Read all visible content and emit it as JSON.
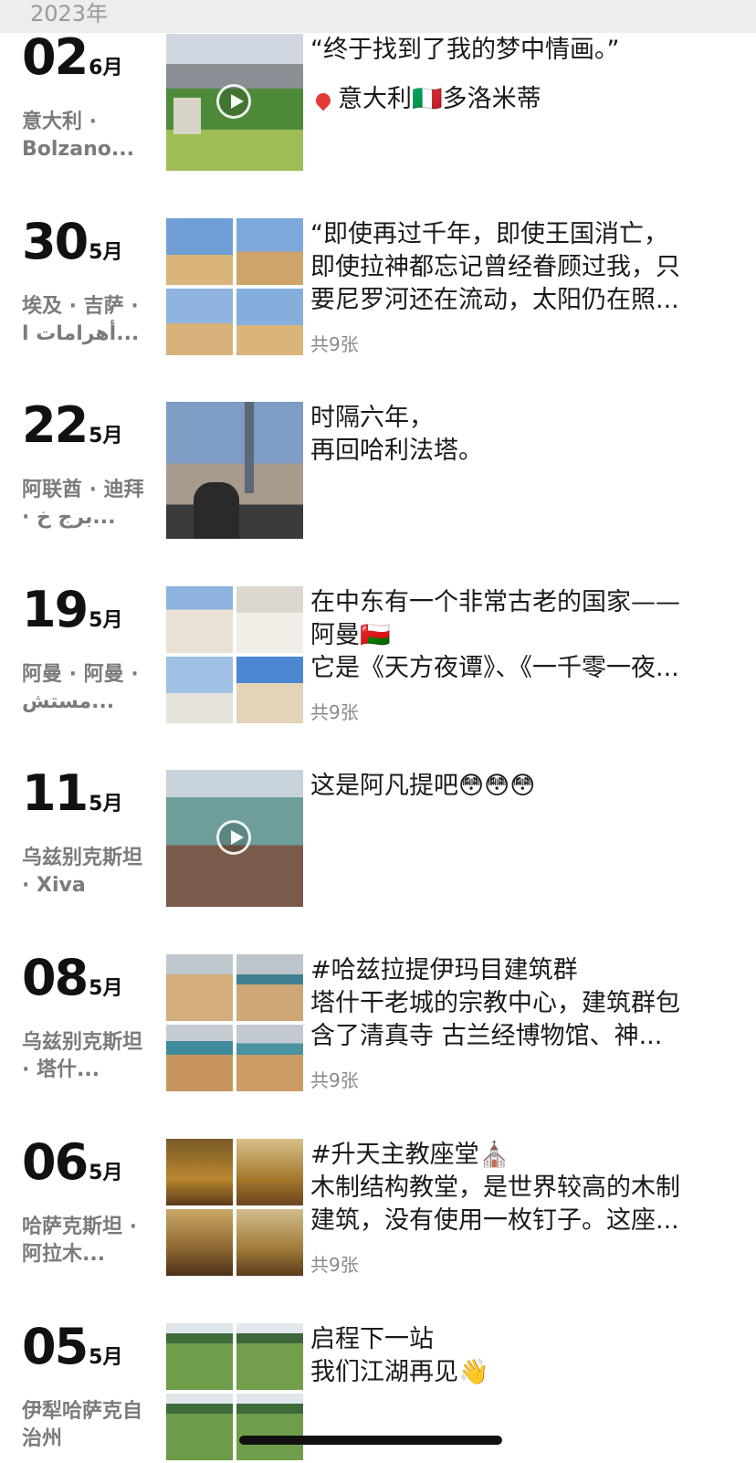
{
  "header": {
    "year": "2023年"
  },
  "posts": [
    {
      "day": "02",
      "month": "6月",
      "location": "意大利 · Bolzano...",
      "media": "video",
      "lines": [
        "“终于找到了我的梦中情画。”",
        "",
        "意大利🇮🇹多洛米蒂"
      ],
      "count": ""
    },
    {
      "day": "30",
      "month": "5月",
      "location": "埃及 · 吉萨 · أهرامات ا...",
      "media": "grid",
      "lines": [
        "“即使再过千年，即使王国消亡，",
        "即使拉神都忘记曾经眷顾过我，只",
        "要尼罗河还在流动，太阳仍在照..."
      ],
      "count": "共9张"
    },
    {
      "day": "22",
      "month": "5月",
      "location": "阿联酋 · 迪拜 · برج خ...",
      "media": "photo",
      "lines": [
        "时隔六年，",
        "再回哈利法塔。"
      ],
      "count": ""
    },
    {
      "day": "19",
      "month": "5月",
      "location": "阿曼 · 阿曼 · مستش...",
      "media": "grid",
      "lines": [
        "在中东有一个非常古老的国家——",
        "阿曼🇴🇲",
        "它是《天方夜谭》、《一千零一夜..."
      ],
      "count": "共9张"
    },
    {
      "day": "11",
      "month": "5月",
      "location": "乌兹别克斯坦 · Xiva",
      "media": "video",
      "lines": [
        "这是阿凡提吧😳😳😳"
      ],
      "count": ""
    },
    {
      "day": "08",
      "month": "5月",
      "location": "乌兹别克斯坦 · 塔什...",
      "media": "grid",
      "lines": [
        "#哈兹拉提伊玛目建筑群",
        "塔什干老城的宗教中心，建筑群包",
        "含了清真寺 古兰经博物馆、神..."
      ],
      "count": "共9张"
    },
    {
      "day": "06",
      "month": "5月",
      "location": "哈萨克斯坦 · 阿拉木...",
      "media": "grid",
      "lines": [
        "#升天主教座堂⛪",
        "木制结构教堂，是世界较高的木制",
        "建筑，没有使用一枚钉子。这座..."
      ],
      "count": "共9张"
    },
    {
      "day": "05",
      "month": "5月",
      "location": "伊犁哈萨克自治州",
      "media": "grid",
      "lines": [
        "启程下一站",
        "我们江湖再见👋"
      ],
      "count": ""
    }
  ],
  "colors": {
    "year_bar": "#ededed",
    "text": "#1a1a1a",
    "meta": "#7b7b7b"
  }
}
